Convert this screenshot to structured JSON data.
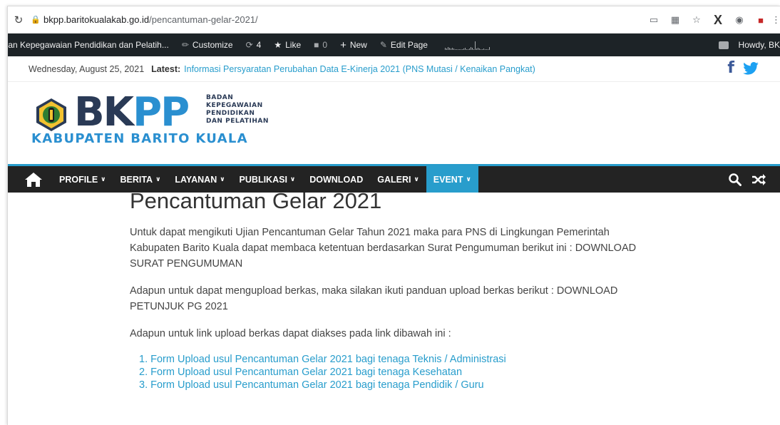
{
  "browser": {
    "url_host": "bkpp.baritokualakab.go.id",
    "url_path": "/pencantuman-gelar-2021/"
  },
  "adminbar": {
    "site_name": "adan Kepegawaian Pendidikan dan Pelatih...",
    "customize": "Customize",
    "updates_count": "4",
    "like": "Like",
    "comments_count": "0",
    "new": "New",
    "edit_page": "Edit Page",
    "howdy": "Howdy, BK"
  },
  "topbar": {
    "date": "Wednesday, August 25, 2021",
    "latest_label": "Latest:",
    "latest_link": "Informasi Persyaratan Perubahan Data E-Kinerja 2021 (PNS Mutasi / Kenaikan Pangkat)"
  },
  "logo": {
    "bk": "BK",
    "pp": "PP",
    "subtitle_lines": [
      "BADAN",
      "KEPEGAWAIAN",
      "PENDIDIKAN",
      "DAN PELATIHAN"
    ],
    "region": "KABUPATEN BARITO KUALA"
  },
  "nav": {
    "items": [
      {
        "label": "PROFILE",
        "dropdown": true
      },
      {
        "label": "BERITA",
        "dropdown": true
      },
      {
        "label": "LAYANAN",
        "dropdown": true
      },
      {
        "label": "PUBLIKASI",
        "dropdown": true
      },
      {
        "label": "DOWNLOAD",
        "dropdown": false
      },
      {
        "label": "GALERI",
        "dropdown": true
      },
      {
        "label": "EVENT",
        "dropdown": true
      }
    ],
    "active_color": "#289dcc"
  },
  "article": {
    "title": "Pencantuman Gelar 2021",
    "paragraphs": [
      "Untuk dapat mengikuti Ujian Pencantuman Gelar Tahun 2021 maka para PNS di Lingkungan Pemerintah Kabupaten Barito Kuala dapat membaca ketentuan berdasarkan Surat Pengumuman berikut ini : DOWNLOAD SURAT PENGUMUMAN",
      "Adapun untuk dapat mengupload berkas, maka silakan ikuti panduan upload berkas berikut : DOWNLOAD PETUNJUK PG 2021",
      "Adapun untuk link upload berkas dapat diakses pada link dibawah ini :"
    ],
    "links": [
      "1. Form Upload usul Pencantuman Gelar 2021 bagi tenaga Teknis / Administrasi",
      "2. Form Upload usul Pencantuman Gelar 2021 bagi tenaga Kesehatan",
      "3. Form Upload usul Pencantuman Gelar 2021 bagi tenaga Pendidik / Guru"
    ]
  },
  "colors": {
    "accent": "#289dcc",
    "adminbar": "#1d2327",
    "nav": "#232323",
    "logo_dark": "#2a3a56",
    "logo_blue": "#2a8fd0"
  }
}
